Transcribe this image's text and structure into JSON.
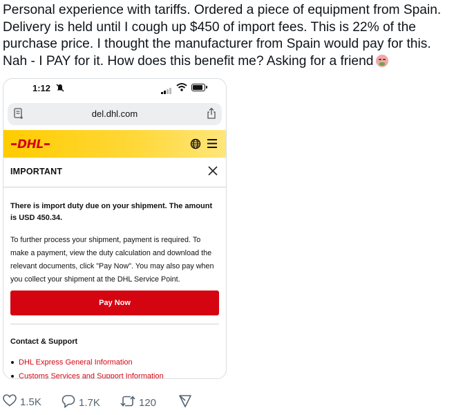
{
  "post": {
    "text": "Personal experience with tariffs. Ordered a piece of equipment from Spain. Delivery is held until I cough up $450 of import fees. This is 22% of the purchase price. I thought the manufacturer from Spain would pay for this. Nah - I PAY for it. How does this benefit me? Asking for a friend",
    "emoji_icon": "nauseated-face-icon"
  },
  "screenshot": {
    "status_bar": {
      "time": "1:12"
    },
    "url_bar": {
      "url": "del.dhl.com"
    },
    "header": {
      "logo_text": "DHL",
      "brand_color": "#d40511",
      "bar_color": "#ffcc00"
    },
    "dialog": {
      "title": "IMPORTANT",
      "duty_notice": "There is import duty due on your shipment. The amount is USD 450.34.",
      "body": "To further process your shipment, payment is required. To make a payment, view the duty calculation and download the relevant documents, click \"Pay Now\". You may also pay when you collect your shipment at the DHL Service Point.",
      "pay_button": "Pay Now",
      "contact_title": "Contact & Support",
      "links": [
        "DHL Express General Information",
        "Customs Services and Support Information"
      ]
    }
  },
  "actions": {
    "likes": "1.5K",
    "replies": "1.7K",
    "reposts": "120"
  }
}
